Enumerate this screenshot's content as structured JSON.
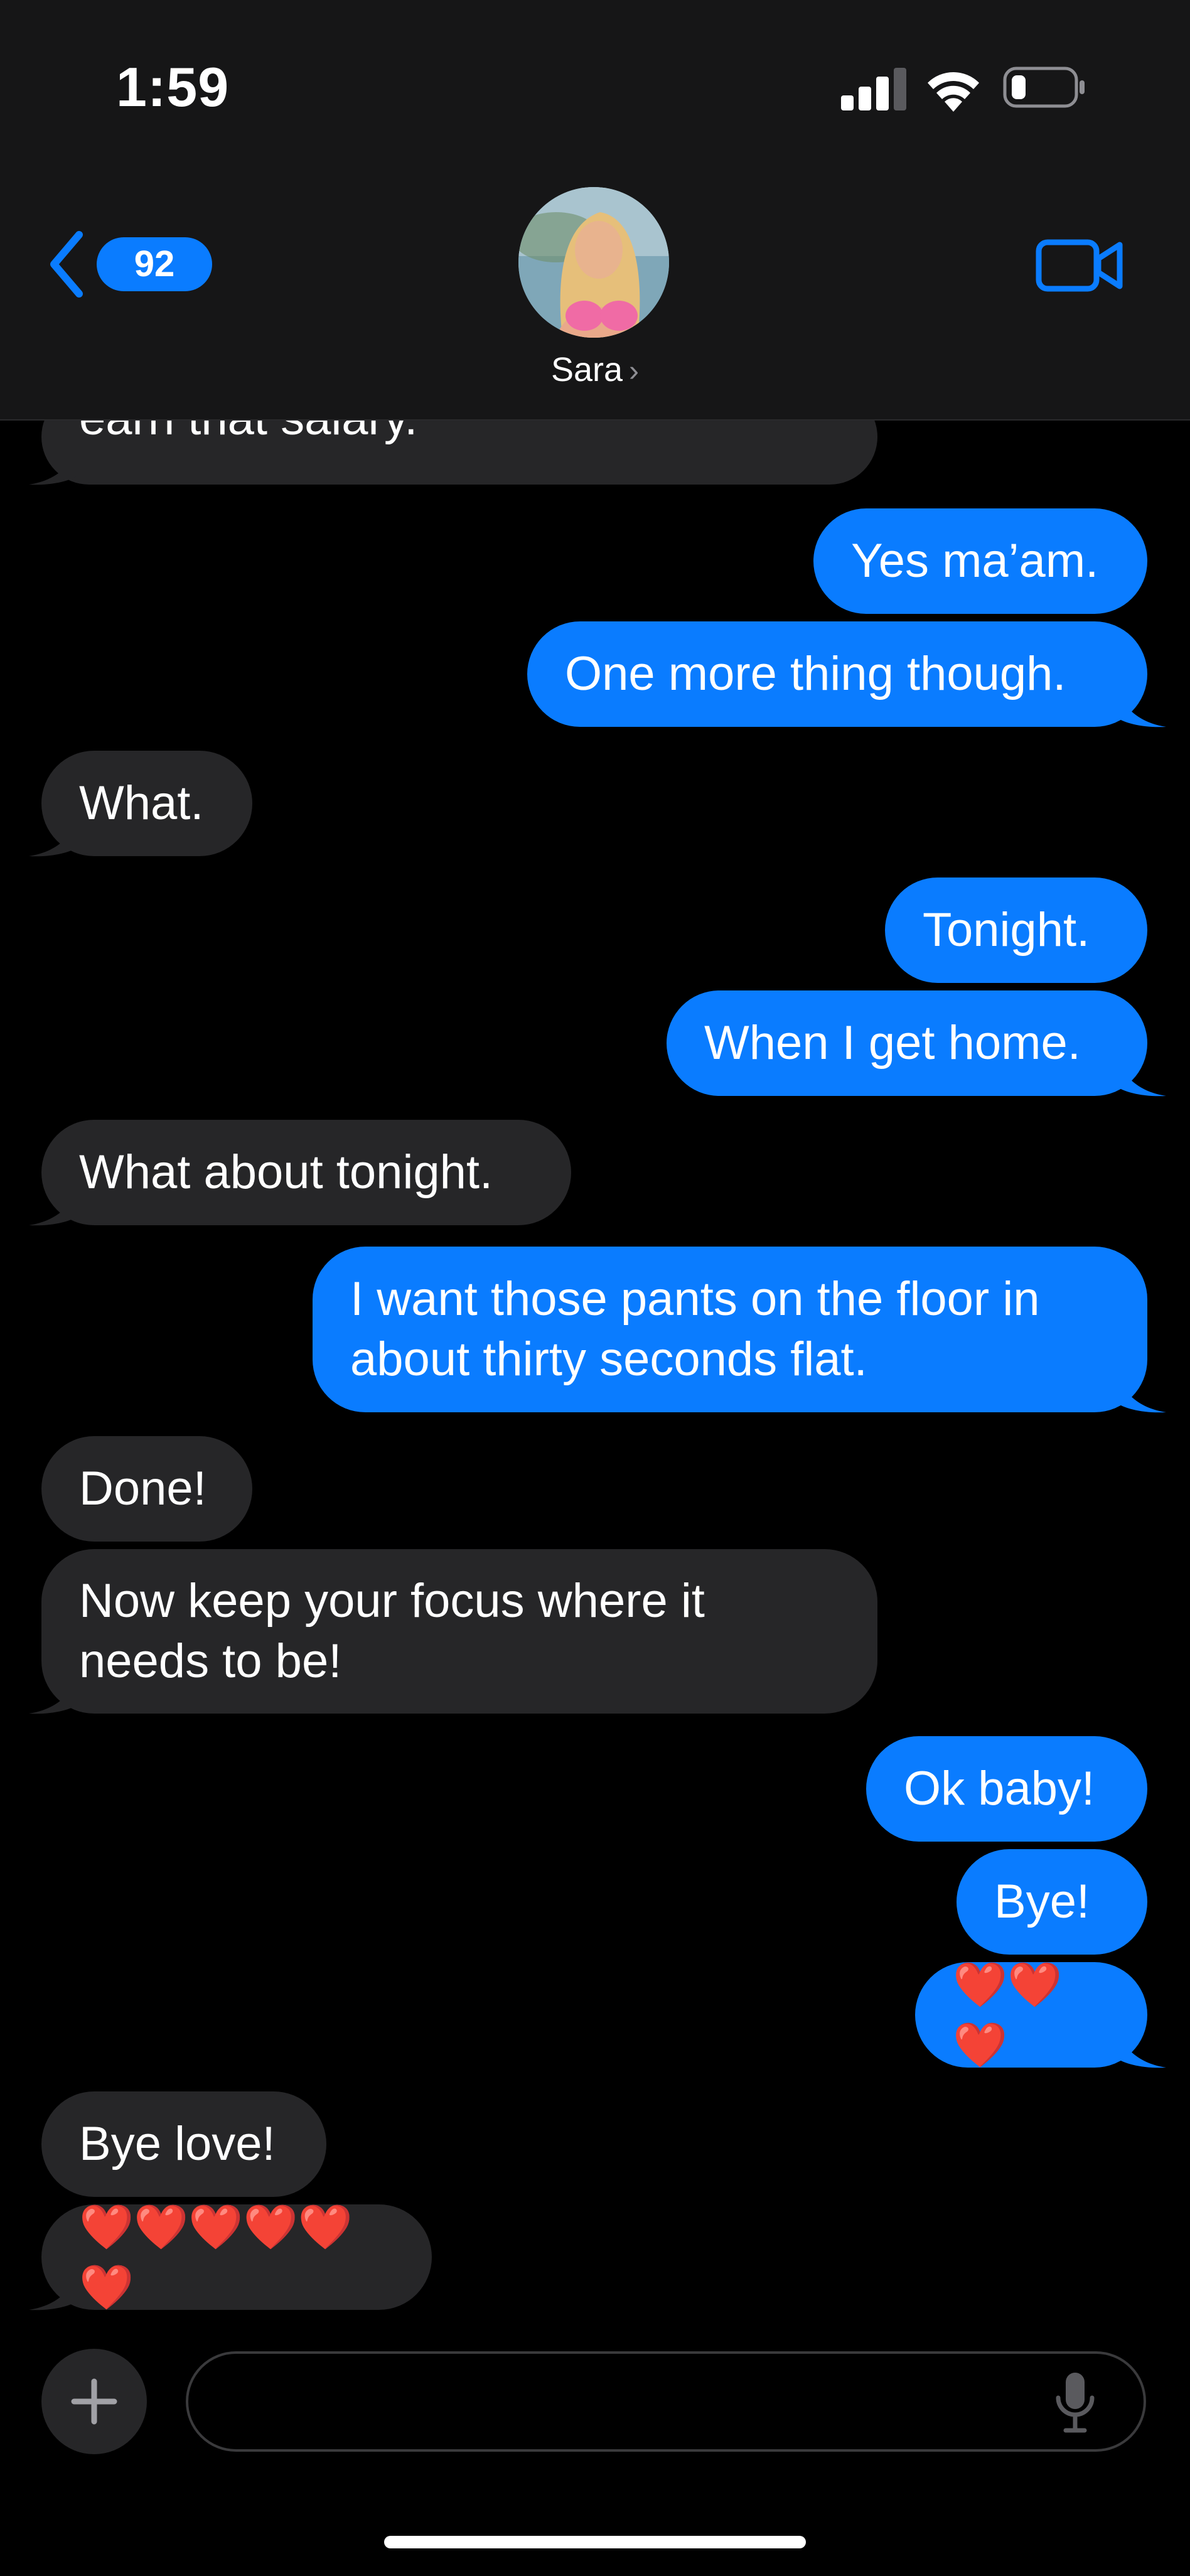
{
  "status_bar": {
    "time": "1:59"
  },
  "header": {
    "back_badge_count": "92",
    "contact_name": "Sara",
    "contact_chevron": "›"
  },
  "messages": [
    {
      "side": "in",
      "text": "earn that salary."
    },
    {
      "side": "out",
      "text": "Yes ma’am."
    },
    {
      "side": "out",
      "text": "One more thing though."
    },
    {
      "side": "in",
      "text": "What."
    },
    {
      "side": "out",
      "text": "Tonight."
    },
    {
      "side": "out",
      "text": "When I get home."
    },
    {
      "side": "in",
      "text": "What about tonight."
    },
    {
      "side": "out",
      "text": "I want those pants on the floor in\nabout thirty seconds flat."
    },
    {
      "side": "in",
      "text": "Done!"
    },
    {
      "side": "in",
      "text": "Now keep your focus where it\nneeds to be!"
    },
    {
      "side": "out",
      "text": "Ok baby!"
    },
    {
      "side": "out",
      "text": "Bye!"
    },
    {
      "side": "out",
      "text": "❤️❤️❤️"
    },
    {
      "side": "in",
      "text": "Bye love!"
    },
    {
      "side": "in",
      "text": "❤️❤️❤️❤️❤️❤️"
    }
  ],
  "composer": {
    "placeholder": ""
  },
  "icons": {
    "back": "chevron-left-icon",
    "video": "video-camera-icon",
    "plus": "plus-icon",
    "mic": "microphone-icon",
    "signal": "cellular-signal-icon",
    "wifi": "wifi-icon",
    "battery": "battery-icon"
  },
  "colors": {
    "accent": "#0a7cff",
    "incoming_bubble": "#262628",
    "background": "#000000",
    "header_bg": "#161617"
  }
}
